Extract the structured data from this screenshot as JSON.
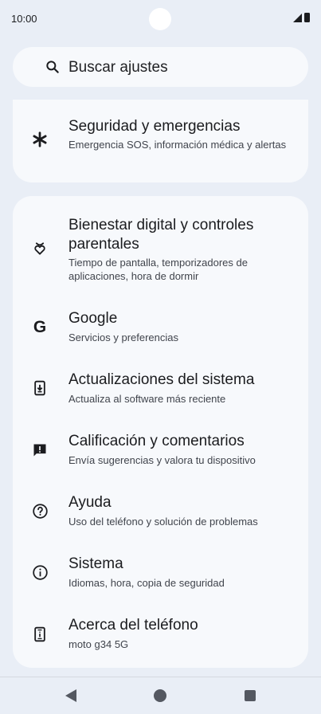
{
  "status_bar": {
    "time": "10:00"
  },
  "search": {
    "placeholder": "Buscar ajustes"
  },
  "settings_top": [
    {
      "icon": "asterisk-icon",
      "title": "Seguridad y emergencias",
      "subtitle": "Emergencia SOS, información médica y alertas"
    }
  ],
  "settings": [
    {
      "icon": "digital-wellbeing-icon",
      "title": "Bienestar digital y controles parentales",
      "subtitle": "Tiempo de pantalla, temporizadores de aplicaciones, hora de dormir"
    },
    {
      "icon": "google-icon",
      "title": "Google",
      "subtitle": "Servicios y preferencias"
    },
    {
      "icon": "system-update-icon",
      "title": "Actualizaciones del sistema",
      "subtitle": "Actualiza al software más reciente"
    },
    {
      "icon": "feedback-icon",
      "title": "Calificación y comentarios",
      "subtitle": "Envía sugerencias y valora tu dispositivo"
    },
    {
      "icon": "help-icon",
      "title": "Ayuda",
      "subtitle": "Uso del teléfono y solución de problemas"
    },
    {
      "icon": "info-icon",
      "title": "Sistema",
      "subtitle": "Idiomas, hora, copia de seguridad"
    },
    {
      "icon": "phone-info-icon",
      "title": "Acerca del teléfono",
      "subtitle": "moto g34 5G"
    }
  ]
}
